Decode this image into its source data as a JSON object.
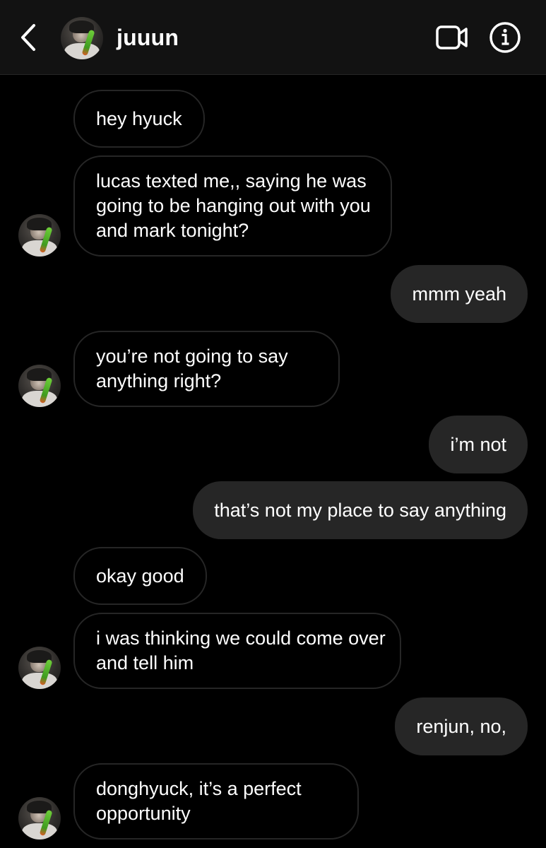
{
  "header": {
    "contact_name": "juuun",
    "back_icon": "chevron-left-icon",
    "video_icon": "video-camera-icon",
    "info_icon": "info-icon"
  },
  "colors": {
    "background": "#000000",
    "header_background": "#121212",
    "outgoing_bubble": "#262626",
    "incoming_border": "#262626",
    "text": "#ffffff"
  },
  "messages": [
    {
      "sender": "juuun",
      "direction": "incoming",
      "text": "hey hyuck"
    },
    {
      "sender": "juuun",
      "direction": "incoming",
      "text": "lucas texted me,, saying he was going to be hanging out with you and mark tonight?"
    },
    {
      "sender": "me",
      "direction": "outgoing",
      "text": "mmm yeah"
    },
    {
      "sender": "juuun",
      "direction": "incoming",
      "text": "you’re not going to say anything right?"
    },
    {
      "sender": "me",
      "direction": "outgoing",
      "text": "i’m not"
    },
    {
      "sender": "me",
      "direction": "outgoing",
      "text": "that’s not my place to say anything"
    },
    {
      "sender": "juuun",
      "direction": "incoming",
      "text": "okay good"
    },
    {
      "sender": "juuun",
      "direction": "incoming",
      "text": "i was thinking we could come over and tell him"
    },
    {
      "sender": "me",
      "direction": "outgoing",
      "text": "renjun, no,"
    },
    {
      "sender": "juuun",
      "direction": "incoming",
      "text": "donghyuck, it’s a perfect opportunity"
    }
  ]
}
